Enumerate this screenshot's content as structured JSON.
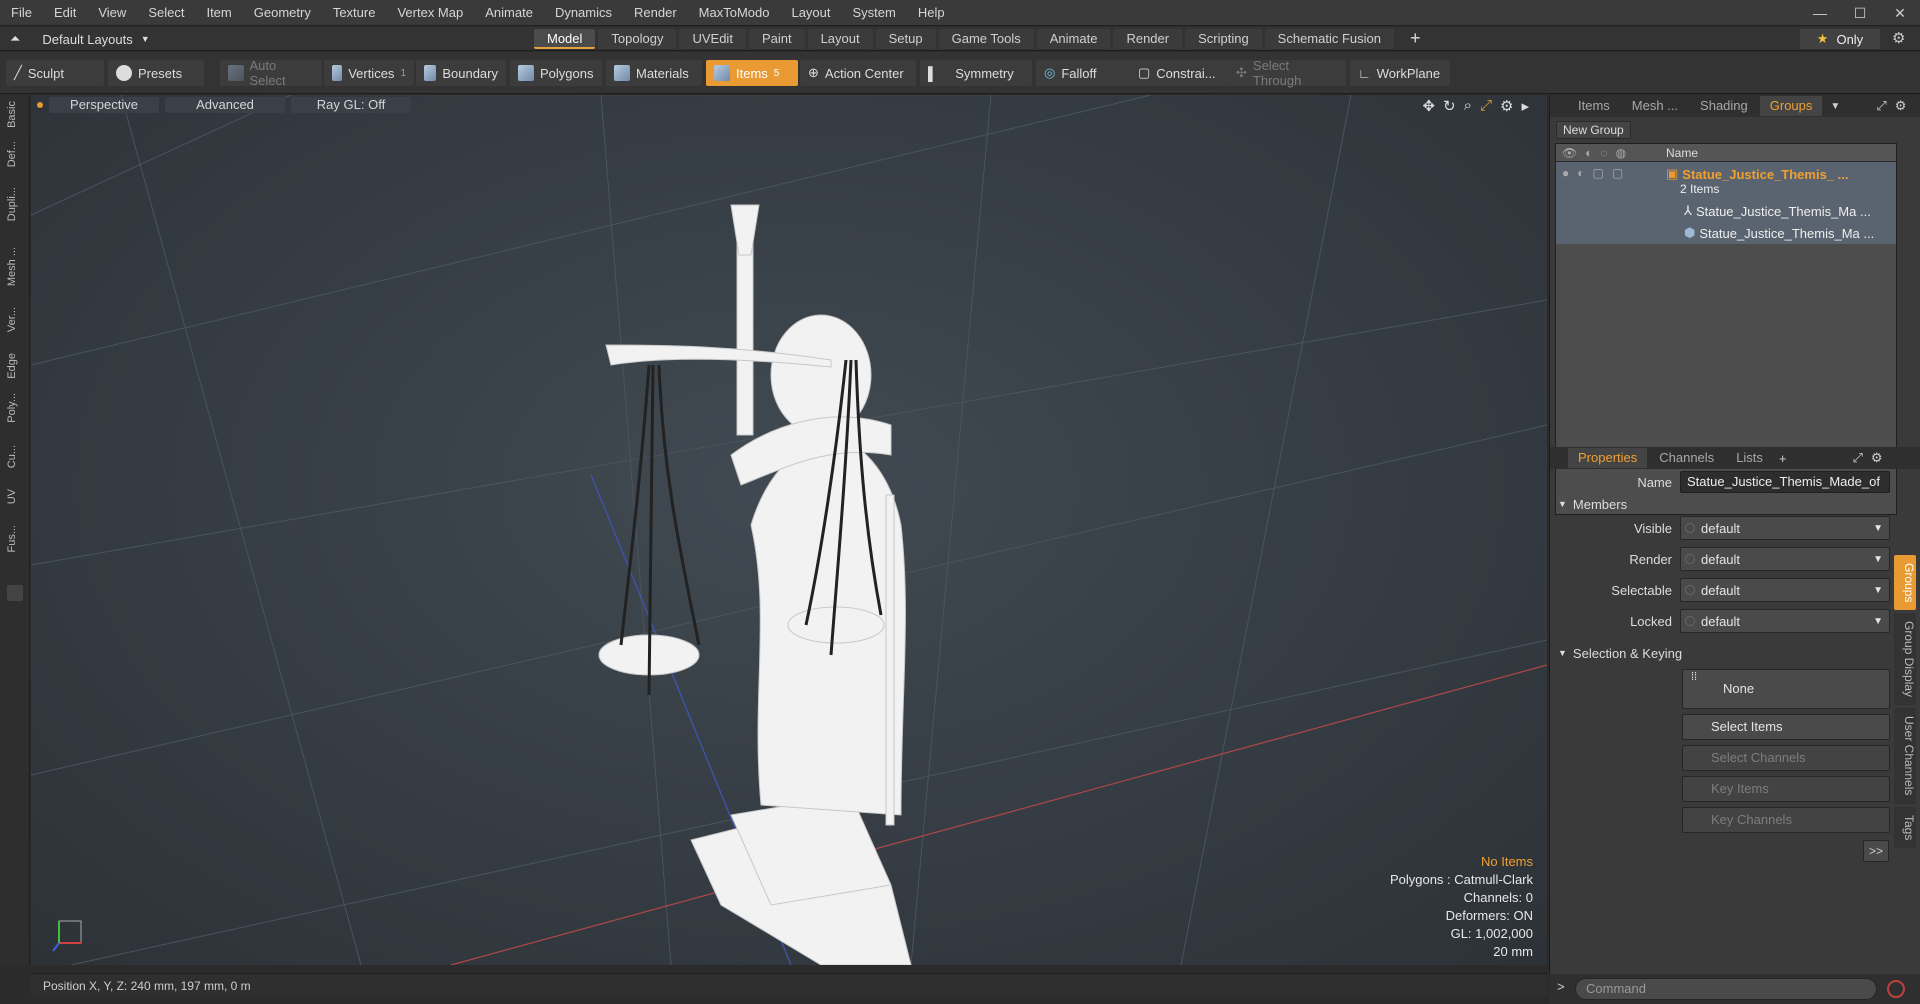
{
  "menu": [
    "File",
    "Edit",
    "View",
    "Select",
    "Item",
    "Geometry",
    "Texture",
    "Vertex Map",
    "Animate",
    "Dynamics",
    "Render",
    "MaxToModo",
    "Layout",
    "System",
    "Help"
  ],
  "layout": {
    "dropdown": "Default Layouts",
    "tabs": [
      "Model",
      "Topology",
      "UVEdit",
      "Paint",
      "Layout",
      "Setup",
      "Game Tools",
      "Animate",
      "Render",
      "Scripting",
      "Schematic Fusion"
    ],
    "active_tab": "Model",
    "only_label": "Only"
  },
  "toolbar": {
    "sculpt": "Sculpt",
    "presets": "Presets",
    "auto_select": "Auto Select",
    "vertices": "Vertices",
    "vertices_count": "1",
    "boundary": "Boundary",
    "polygons": "Polygons",
    "materials": "Materials",
    "items": "Items",
    "items_count": "5",
    "action_center": "Action Center",
    "symmetry": "Symmetry",
    "falloff": "Falloff",
    "constraints": "Constrai...",
    "select_through": "Select Through",
    "workplane": "WorkPlane"
  },
  "left_tabs": [
    "Basic",
    "Def...",
    "Dupli...",
    "Mesh ...",
    "Ver...",
    "Edge",
    "Poly...",
    "Cu...",
    "UV",
    "Fus..."
  ],
  "viewport": {
    "view_mode": "Perspective",
    "shading": "Advanced",
    "raygl": "Ray GL: Off",
    "info": {
      "selection": "No Items",
      "polygons": "Polygons : Catmull-Clark",
      "channels": "Channels: 0",
      "deformers": "Deformers: ON",
      "gl": "GL: 1,002,000",
      "scale": "20 mm"
    }
  },
  "status": "Position X, Y, Z:  240 mm, 197 mm, 0 m",
  "right_panel": {
    "top_tabs": [
      "Items",
      "Mesh ...",
      "Shading",
      "Groups"
    ],
    "active_top_tab": "Groups",
    "new_group": "New Group",
    "col_name": "Name",
    "group": {
      "name": "Statue_Justice_Themis_ ...",
      "count": "2 Items",
      "children": [
        "Statue_Justice_Themis_Ma ...",
        "Statue_Justice_Themis_Ma ..."
      ]
    },
    "prop_tabs": [
      "Properties",
      "Channels",
      "Lists"
    ],
    "active_prop_tab": "Properties",
    "name_label": "Name",
    "name_value": "Statue_Justice_Themis_Made_of",
    "members_label": "Members",
    "visible_label": "Visible",
    "render_label": "Render",
    "selectable_label": "Selectable",
    "locked_label": "Locked",
    "dropdown_value": "default",
    "sel_keying_label": "Selection & Keying",
    "none_label": "None",
    "select_items": "Select Items",
    "select_channels": "Select Channels",
    "key_items": "Key Items",
    "key_channels": "Key Channels",
    "more": ">>",
    "side_tabs": [
      "Groups",
      "Group Display",
      "User Channels",
      "Tags"
    ],
    "command_placeholder": "Command"
  },
  "colors": {
    "accent": "#e99a32",
    "viewport_bg": "#3a4249"
  }
}
